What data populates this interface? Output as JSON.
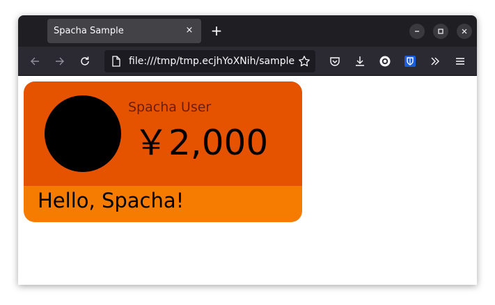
{
  "browser": {
    "tab_title": "Spacha Sample",
    "tab_close_glyph": "×",
    "new_tab_glyph": "+",
    "url": "file:///tmp/tmp.ecjhYoXNih/sample.html"
  },
  "card": {
    "user_name": "Spacha User",
    "amount": "￥2,000",
    "message": "Hello, Spacha!"
  },
  "colors": {
    "card_top": "#e55200",
    "card_bottom": "#f57c00",
    "avatar": "#000000",
    "user_name": "#6b1e0a"
  },
  "icons": {
    "back": "arrow-left-icon",
    "forward": "arrow-right-icon",
    "reload": "reload-icon",
    "page": "page-icon",
    "bookmark": "star-icon",
    "pocket": "pocket-icon",
    "downloads": "download-icon",
    "extension": "extension-icon",
    "bitwarden": "bitwarden-shield-icon",
    "more": "chevrons-right-icon",
    "menu": "hamburger-menu-icon"
  }
}
